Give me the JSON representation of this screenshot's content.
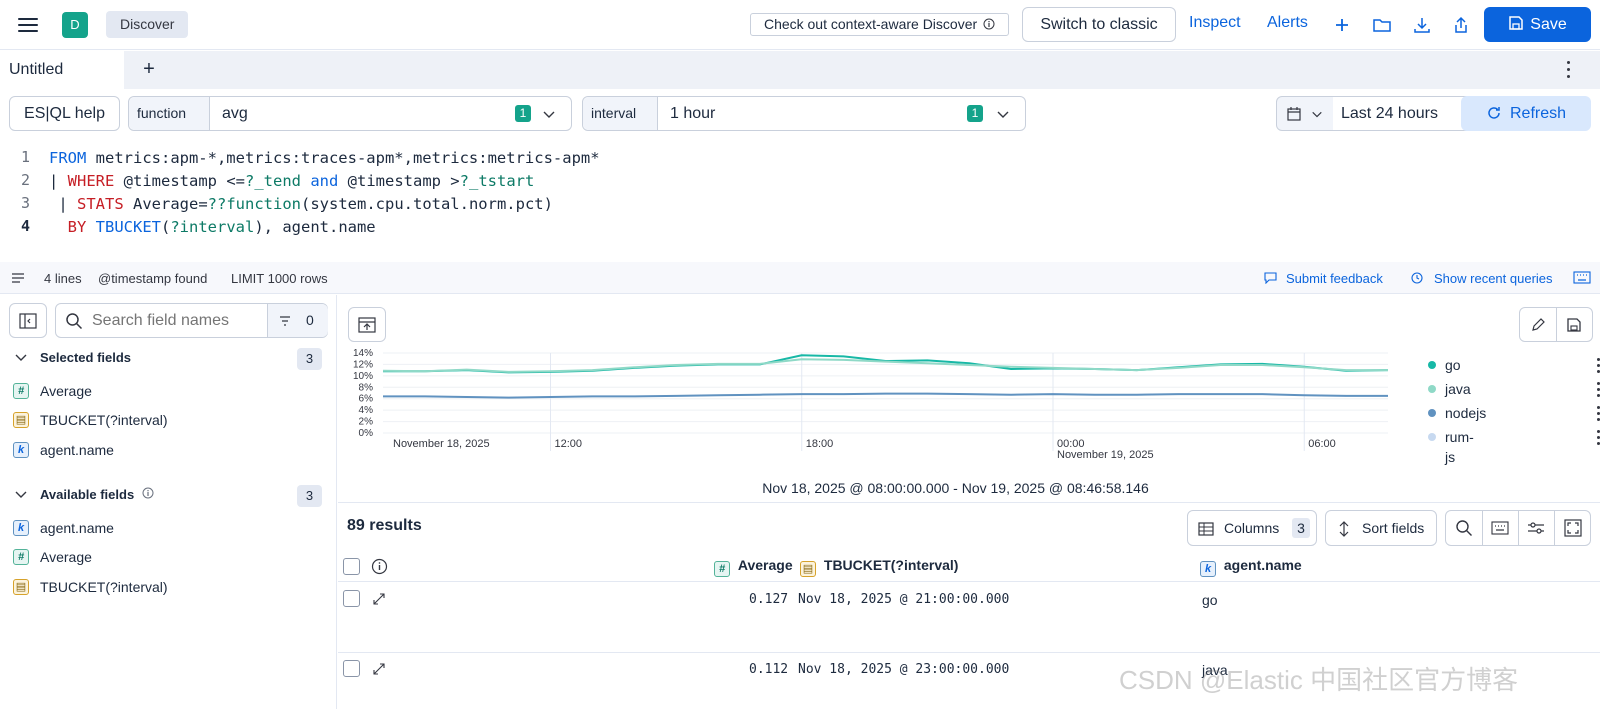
{
  "header": {
    "app_badge": "D",
    "breadcrumb": "Discover",
    "context_aware": "Check out context-aware Discover",
    "switch_classic": "Switch to classic",
    "inspect": "Inspect",
    "alerts": "Alerts",
    "save": "Save",
    "accent_color": "#0b64dd"
  },
  "tabs": {
    "active": "Untitled",
    "add": "+"
  },
  "controls": {
    "esql_help": "ES|QL help",
    "function_label": "function",
    "function_value": "avg",
    "function_count": "1",
    "interval_label": "interval",
    "interval_value": "1 hour",
    "interval_count": "1",
    "date_range": "Last 24 hours",
    "refresh": "Refresh"
  },
  "editor": {
    "line_numbers": [
      "1",
      "2",
      "3",
      "4"
    ],
    "line1": {
      "kw": "FROM",
      "rest": " metrics:apm-*,metrics:traces-apm*,metrics:metrics-apm*"
    },
    "line2": {
      "pipe": "| ",
      "kw": "WHERE",
      "a": " @timestamp <=",
      "p1": "?_tend",
      "and": " and",
      "b": " @timestamp >",
      "p2": "?_tstart"
    },
    "line3": {
      "pipe": " | ",
      "kw": "STATS",
      "a": " Average=",
      "p1": "??function",
      "b": "(system.cpu.total.norm.pct)"
    },
    "line4": {
      "kw": "  BY",
      "fn": " TBUCKET",
      "a": "(",
      "p1": "?interval",
      "b": "), agent.name"
    }
  },
  "status": {
    "lines": "4 lines",
    "timestamp": "@timestamp found",
    "limit": "LIMIT 1000 rows",
    "feedback": "Submit feedback",
    "recent": "Show recent queries"
  },
  "sidebar": {
    "search_placeholder": "Search field names",
    "filter_count": "0",
    "selected_title": "Selected fields",
    "selected_count": "3",
    "selected_fields": [
      {
        "type": "number",
        "name": "Average"
      },
      {
        "type": "date",
        "name": "TBUCKET(?interval)"
      },
      {
        "type": "keyword",
        "name": "agent.name"
      }
    ],
    "available_title": "Available fields",
    "available_count": "3",
    "available_fields": [
      {
        "type": "keyword",
        "name": "agent.name"
      },
      {
        "type": "number",
        "name": "Average"
      },
      {
        "type": "date",
        "name": "TBUCKET(?interval)"
      }
    ]
  },
  "chart_data": {
    "type": "line",
    "ylim": [
      0,
      14
    ],
    "y_ticks": [
      "14%",
      "12%",
      "10%",
      "8%",
      "6%",
      "4%",
      "2%",
      "0%"
    ],
    "x_ticks": [
      {
        "label": "November 18, 2025",
        "sub": ""
      },
      {
        "label": "12:00",
        "sub": ""
      },
      {
        "label": "18:00",
        "sub": ""
      },
      {
        "label": "00:00",
        "sub": "November 19, 2025"
      },
      {
        "label": "06:00",
        "sub": ""
      }
    ],
    "x": [
      "08:00",
      "09:00",
      "10:00",
      "11:00",
      "12:00",
      "13:00",
      "14:00",
      "15:00",
      "16:00",
      "17:00",
      "18:00",
      "19:00",
      "20:00",
      "21:00",
      "22:00",
      "23:00",
      "00:00",
      "01:00",
      "02:00",
      "03:00",
      "04:00",
      "05:00",
      "06:00",
      "07:00",
      "08:00"
    ],
    "series": [
      {
        "name": "go",
        "color": "#17b8a6",
        "values": [
          10.8,
          10.8,
          11.0,
          10.6,
          10.7,
          10.9,
          11.4,
          11.8,
          12.0,
          12.0,
          13.6,
          13.4,
          12.6,
          12.7,
          12.2,
          11.2,
          11.3,
          11.2,
          11.0,
          11.5,
          12.0,
          12.1,
          11.6,
          10.9,
          11.0
        ]
      },
      {
        "name": "java",
        "color": "#8fd9c7",
        "values": [
          10.9,
          10.8,
          11.1,
          10.7,
          10.8,
          11.0,
          11.5,
          11.9,
          12.1,
          12.1,
          12.9,
          12.8,
          12.5,
          12.2,
          11.9,
          11.6,
          11.4,
          11.2,
          11.0,
          11.4,
          11.9,
          11.9,
          11.5,
          11.0,
          11.0
        ]
      },
      {
        "name": "nodejs",
        "color": "#6092c0",
        "values": [
          6.4,
          6.4,
          6.3,
          6.2,
          6.3,
          6.4,
          6.4,
          6.5,
          6.6,
          6.7,
          6.8,
          6.8,
          6.9,
          6.9,
          6.8,
          6.7,
          6.8,
          6.7,
          6.7,
          6.8,
          6.8,
          6.8,
          6.6,
          6.5,
          6.5
        ]
      },
      {
        "name": "rum-js",
        "color": "#c7d9f0",
        "values": []
      }
    ]
  },
  "timerange": "Nov 18, 2025 @ 08:00:00.000 - Nov 19, 2025 @ 08:46:58.146",
  "table": {
    "results": "89 results",
    "columns_label": "Columns",
    "columns_count": "3",
    "sort_label": "Sort fields",
    "headers": [
      "Average",
      "TBUCKET(?interval)",
      "agent.name"
    ],
    "rows": [
      {
        "average": "0.127",
        "bucket": "Nov 18, 2025 @ 21:00:00.000",
        "agent": "go"
      },
      {
        "average": "0.112",
        "bucket": "Nov 18, 2025 @ 23:00:00.000",
        "agent": "java"
      }
    ]
  },
  "watermark": "CSDN @Elastic 中国社区官方博客"
}
